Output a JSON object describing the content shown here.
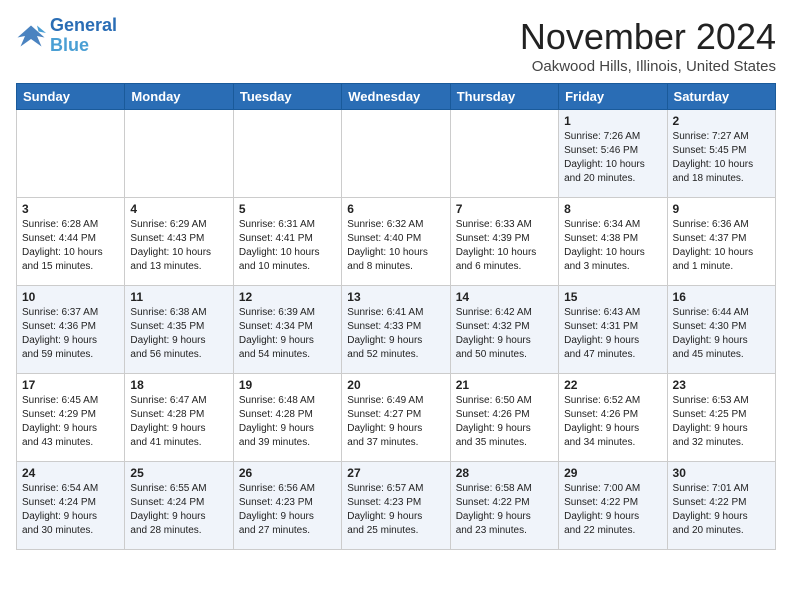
{
  "logo": {
    "line1": "General",
    "line2": "Blue"
  },
  "title": "November 2024",
  "subtitle": "Oakwood Hills, Illinois, United States",
  "days_of_week": [
    "Sunday",
    "Monday",
    "Tuesday",
    "Wednesday",
    "Thursday",
    "Friday",
    "Saturday"
  ],
  "weeks": [
    [
      {
        "day": "",
        "info": ""
      },
      {
        "day": "",
        "info": ""
      },
      {
        "day": "",
        "info": ""
      },
      {
        "day": "",
        "info": ""
      },
      {
        "day": "",
        "info": ""
      },
      {
        "day": "1",
        "info": "Sunrise: 7:26 AM\nSunset: 5:46 PM\nDaylight: 10 hours\nand 20 minutes."
      },
      {
        "day": "2",
        "info": "Sunrise: 7:27 AM\nSunset: 5:45 PM\nDaylight: 10 hours\nand 18 minutes."
      }
    ],
    [
      {
        "day": "3",
        "info": "Sunrise: 6:28 AM\nSunset: 4:44 PM\nDaylight: 10 hours\nand 15 minutes."
      },
      {
        "day": "4",
        "info": "Sunrise: 6:29 AM\nSunset: 4:43 PM\nDaylight: 10 hours\nand 13 minutes."
      },
      {
        "day": "5",
        "info": "Sunrise: 6:31 AM\nSunset: 4:41 PM\nDaylight: 10 hours\nand 10 minutes."
      },
      {
        "day": "6",
        "info": "Sunrise: 6:32 AM\nSunset: 4:40 PM\nDaylight: 10 hours\nand 8 minutes."
      },
      {
        "day": "7",
        "info": "Sunrise: 6:33 AM\nSunset: 4:39 PM\nDaylight: 10 hours\nand 6 minutes."
      },
      {
        "day": "8",
        "info": "Sunrise: 6:34 AM\nSunset: 4:38 PM\nDaylight: 10 hours\nand 3 minutes."
      },
      {
        "day": "9",
        "info": "Sunrise: 6:36 AM\nSunset: 4:37 PM\nDaylight: 10 hours\nand 1 minute."
      }
    ],
    [
      {
        "day": "10",
        "info": "Sunrise: 6:37 AM\nSunset: 4:36 PM\nDaylight: 9 hours\nand 59 minutes."
      },
      {
        "day": "11",
        "info": "Sunrise: 6:38 AM\nSunset: 4:35 PM\nDaylight: 9 hours\nand 56 minutes."
      },
      {
        "day": "12",
        "info": "Sunrise: 6:39 AM\nSunset: 4:34 PM\nDaylight: 9 hours\nand 54 minutes."
      },
      {
        "day": "13",
        "info": "Sunrise: 6:41 AM\nSunset: 4:33 PM\nDaylight: 9 hours\nand 52 minutes."
      },
      {
        "day": "14",
        "info": "Sunrise: 6:42 AM\nSunset: 4:32 PM\nDaylight: 9 hours\nand 50 minutes."
      },
      {
        "day": "15",
        "info": "Sunrise: 6:43 AM\nSunset: 4:31 PM\nDaylight: 9 hours\nand 47 minutes."
      },
      {
        "day": "16",
        "info": "Sunrise: 6:44 AM\nSunset: 4:30 PM\nDaylight: 9 hours\nand 45 minutes."
      }
    ],
    [
      {
        "day": "17",
        "info": "Sunrise: 6:45 AM\nSunset: 4:29 PM\nDaylight: 9 hours\nand 43 minutes."
      },
      {
        "day": "18",
        "info": "Sunrise: 6:47 AM\nSunset: 4:28 PM\nDaylight: 9 hours\nand 41 minutes."
      },
      {
        "day": "19",
        "info": "Sunrise: 6:48 AM\nSunset: 4:28 PM\nDaylight: 9 hours\nand 39 minutes."
      },
      {
        "day": "20",
        "info": "Sunrise: 6:49 AM\nSunset: 4:27 PM\nDaylight: 9 hours\nand 37 minutes."
      },
      {
        "day": "21",
        "info": "Sunrise: 6:50 AM\nSunset: 4:26 PM\nDaylight: 9 hours\nand 35 minutes."
      },
      {
        "day": "22",
        "info": "Sunrise: 6:52 AM\nSunset: 4:26 PM\nDaylight: 9 hours\nand 34 minutes."
      },
      {
        "day": "23",
        "info": "Sunrise: 6:53 AM\nSunset: 4:25 PM\nDaylight: 9 hours\nand 32 minutes."
      }
    ],
    [
      {
        "day": "24",
        "info": "Sunrise: 6:54 AM\nSunset: 4:24 PM\nDaylight: 9 hours\nand 30 minutes."
      },
      {
        "day": "25",
        "info": "Sunrise: 6:55 AM\nSunset: 4:24 PM\nDaylight: 9 hours\nand 28 minutes."
      },
      {
        "day": "26",
        "info": "Sunrise: 6:56 AM\nSunset: 4:23 PM\nDaylight: 9 hours\nand 27 minutes."
      },
      {
        "day": "27",
        "info": "Sunrise: 6:57 AM\nSunset: 4:23 PM\nDaylight: 9 hours\nand 25 minutes."
      },
      {
        "day": "28",
        "info": "Sunrise: 6:58 AM\nSunset: 4:22 PM\nDaylight: 9 hours\nand 23 minutes."
      },
      {
        "day": "29",
        "info": "Sunrise: 7:00 AM\nSunset: 4:22 PM\nDaylight: 9 hours\nand 22 minutes."
      },
      {
        "day": "30",
        "info": "Sunrise: 7:01 AM\nSunset: 4:22 PM\nDaylight: 9 hours\nand 20 minutes."
      }
    ]
  ]
}
